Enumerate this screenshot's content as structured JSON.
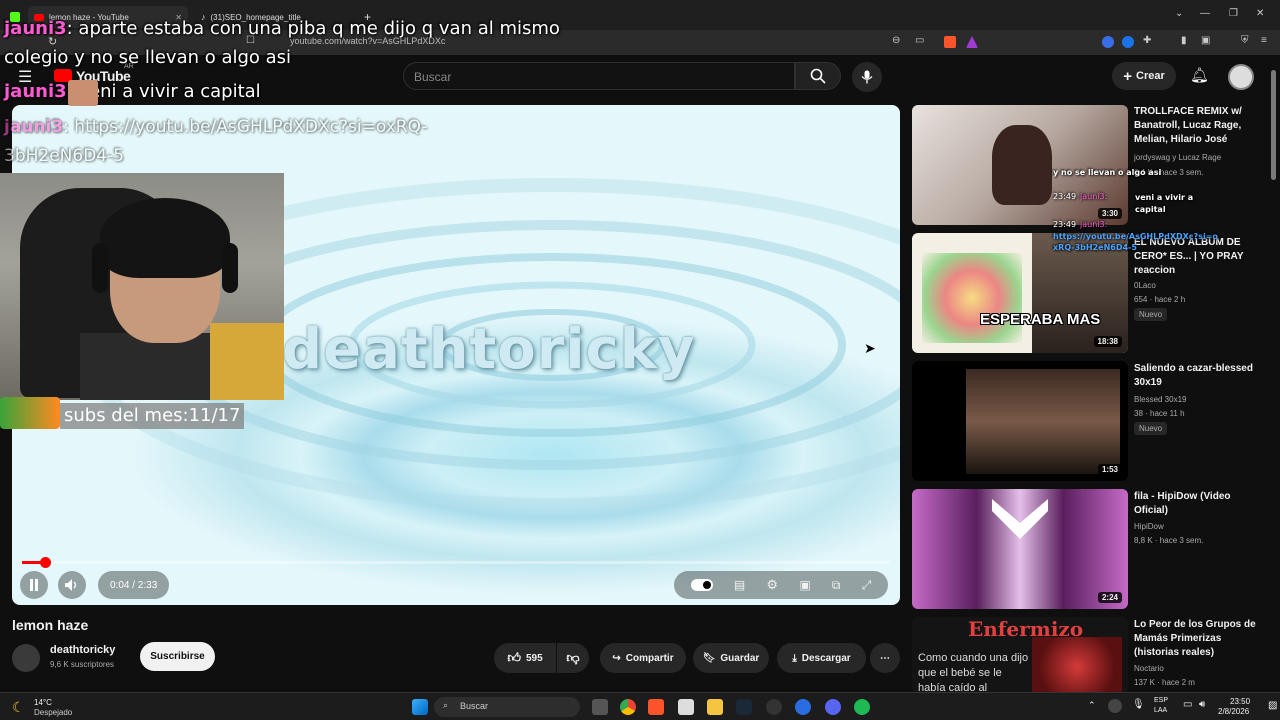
{
  "browser": {
    "tabs": [
      {
        "label": "lemon haze - YouTube"
      },
      {
        "label": "(31)SEO_homepage_title"
      }
    ],
    "url": "youtube.com/watch?v=AsGHLPdXDXc"
  },
  "youtube": {
    "logo": "YouTube",
    "logo_region": "AR",
    "search_placeholder": "Buscar",
    "create_label": "Crear"
  },
  "player": {
    "watermark": "deathtoricky",
    "time": "0:04 / 2:33",
    "progress_fraction": 0.026
  },
  "stream_overlay": {
    "chat": [
      {
        "nick": "jauni3",
        "text": ": aparte estaba con una piba q me dijo q van al mismo"
      },
      {
        "nick": "",
        "text": "colegio y no se llevan o algo asi"
      },
      {
        "nick": "jauni3",
        "text": ":  veni a vivir a capital"
      },
      {
        "nick": "jauni3",
        "text": ": https://youtu.be/AsGHLPdXDXc?si=oxRQ-"
      },
      {
        "nick": "",
        "text": "3bH2eN6D4-5"
      }
    ],
    "subs_label": "subs del mes:11/17",
    "side_chat": [
      "y no se llevan o algo asi",
      "23:49",
      "jauni3:",
      "veni a vivir a capital",
      "23:49",
      "jauni3:",
      "https://youtu.be/AsGHLPdXDXc?si=oxRQ-3bH2eN6D4-5"
    ]
  },
  "video": {
    "title": "lemon haze",
    "channel": "deathtoricky",
    "subscribers": "9,6 K suscriptores",
    "subscribe_label": "Suscribirse",
    "likes": "595",
    "share_label": "Compartir",
    "save_label": "Guardar",
    "download_label": "Descargar"
  },
  "recommendations": [
    {
      "title": "TROLLFACE REMIX w/ Banatroll, Lucaz Rage, Melian, Hilario José",
      "channel": "jordyswag y Lucaz Rage",
      "meta": "8,4 K · hace 3 sem.",
      "duration": "3:30",
      "badge": "",
      "thumb_color": "#c9c3bf"
    },
    {
      "title": "EL NUEVO ÁLBUM DE CERO* ES... | YO PRAY reaccion",
      "channel": "0Laco",
      "meta": "654 · hace 2 h",
      "duration": "18:38",
      "badge": "Nuevo",
      "thumb_text": "ESPERABA MAS",
      "thumb_color": "#f4efe4"
    },
    {
      "title": "Saliendo a cazar-blessed 30x19",
      "channel": "Blessed 30x19",
      "meta": "38 · hace 11 h",
      "duration": "1:53",
      "badge": "Nuevo",
      "thumb_color": "#2a1e18"
    },
    {
      "title": "fila - HipiDow (Video Oficial)",
      "channel": "HipiDow",
      "meta": "8,8 K · hace 3 sem.",
      "duration": "2:24",
      "badge": "",
      "thumb_color": "#6d2b6e"
    },
    {
      "title": "Lo Peor de los Grupos de Mamás Primerizas (historias reales)",
      "channel": "Noctario",
      "meta": "137 K · hace 2 m",
      "duration": "",
      "badge": "",
      "thumb_text": "Enfermizo",
      "thumb_sub": "Como cuando una dijo que el bebé se le había caído al",
      "thumb_color": "#1a1a1a"
    }
  ],
  "taskbar": {
    "weather_temp": "14°C",
    "weather_desc": "Despejado",
    "search_label": "Buscar",
    "lang": "ESP",
    "lang2": "LAA",
    "time": "23:50",
    "date": "2/8/2026"
  }
}
